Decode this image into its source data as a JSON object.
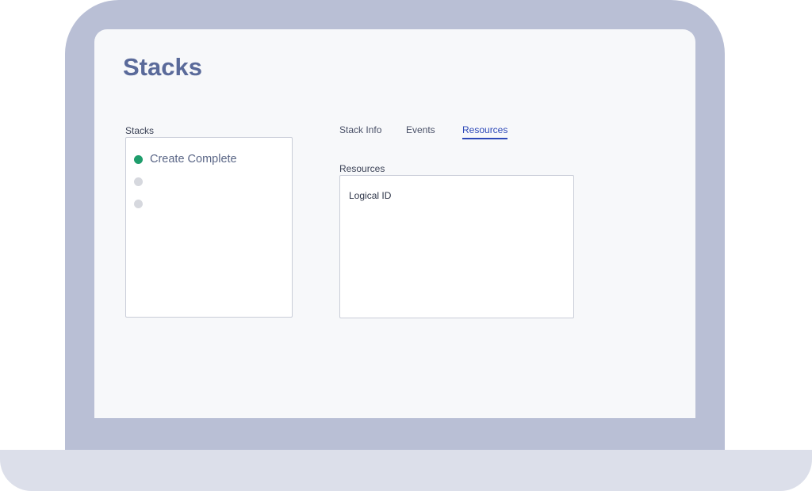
{
  "page": {
    "title": "Stacks"
  },
  "stacks_panel": {
    "label": "Stacks",
    "items": [
      {
        "label": "Create Complete",
        "status": "complete",
        "status_color": "#1f9d6c"
      },
      {
        "label": "",
        "status": "placeholder",
        "status_color": "#d6d8de"
      },
      {
        "label": "",
        "status": "placeholder",
        "status_color": "#d6d8de"
      }
    ]
  },
  "tabs": [
    {
      "label": "Stack Info",
      "active": false
    },
    {
      "label": "Events",
      "active": false
    },
    {
      "label": "Resources",
      "active": true
    }
  ],
  "resources_panel": {
    "label": "Resources",
    "columns": [
      "Logical ID"
    ]
  },
  "colors": {
    "accent": "#2c48b8",
    "title": "#5a6a9a",
    "device_frame": "#b9bfd5",
    "device_base": "#dcdfea"
  }
}
